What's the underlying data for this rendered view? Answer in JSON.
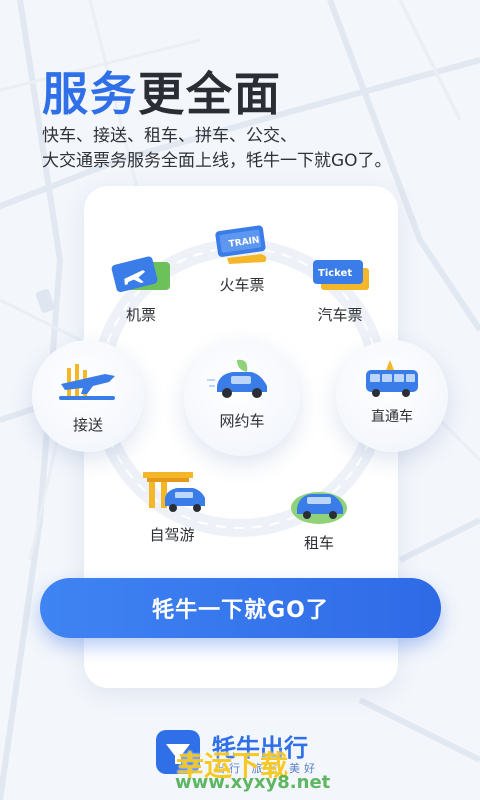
{
  "headline": {
    "part1": "服务",
    "part2": "更全面"
  },
  "subtext": {
    "line1": "快车、接送、租车、拼车、公交、",
    "line2": "大交通票务服务全面上线，牦牛一下就GO了。"
  },
  "services": {
    "train": {
      "label": "火车票",
      "icon": "train-ticket-icon"
    },
    "flight": {
      "label": "机票",
      "icon": "plane-ticket-icon"
    },
    "bus": {
      "label": "汽车票",
      "icon": "bus-ticket-icon"
    },
    "pickup": {
      "label": "接送",
      "icon": "airport-pickup-icon"
    },
    "ridehail": {
      "label": "网约车",
      "icon": "car-icon"
    },
    "express": {
      "label": "直通车",
      "icon": "shuttle-bus-icon"
    },
    "selfdrive": {
      "label": "自驾游",
      "icon": "self-drive-tour-icon"
    },
    "rental": {
      "label": "租车",
      "icon": "rental-car-icon"
    }
  },
  "cta": {
    "label": "牦牛一下就GO了"
  },
  "brand": {
    "name": "牦牛出行",
    "slogan": "出行 旅途 美好"
  },
  "watermark": {
    "title": "幸运下载",
    "url": "www.xyxy8.net"
  },
  "colors": {
    "primary": "#2f6fe8",
    "text": "#2a2d33",
    "card": "#ffffff"
  }
}
